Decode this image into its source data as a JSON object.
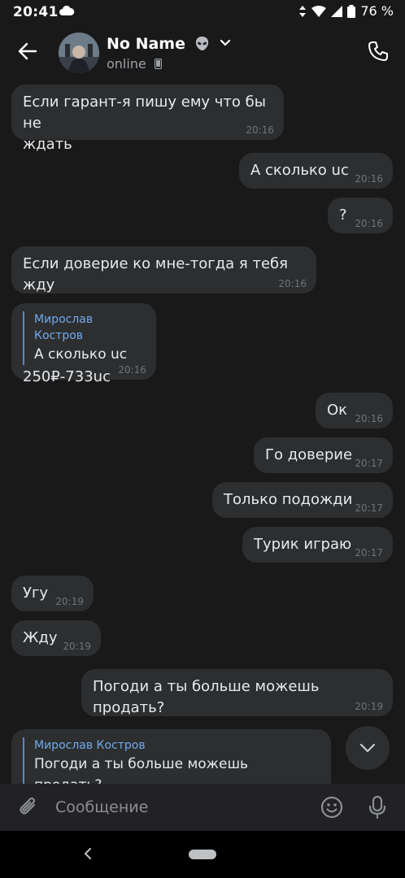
{
  "status_bar": {
    "time": "20:41",
    "battery": "76 %"
  },
  "header": {
    "name": "No Name",
    "status": "online"
  },
  "messages": [
    {
      "side": "in",
      "lines": [
        "Если гарант-я пишу ему что бы не",
        "ждать"
      ],
      "time": "20:16"
    },
    {
      "side": "out",
      "lines": [
        "А сколько uc"
      ],
      "time": "20:16"
    },
    {
      "side": "out",
      "lines": [
        "?"
      ],
      "time": "20:16"
    },
    {
      "side": "in",
      "lines": [
        "Если доверие ко мне-тогда я тебя жду"
      ],
      "time": "20:16"
    },
    {
      "side": "in",
      "quote_author": "Мирослав Костров",
      "quote_text": "А сколько uc",
      "lines": [
        "250₽-733uc"
      ],
      "time": "20:16"
    },
    {
      "side": "out",
      "lines": [
        "Ок"
      ],
      "time": "20:16"
    },
    {
      "side": "out",
      "lines": [
        "Го доверие"
      ],
      "time": "20:17"
    },
    {
      "side": "out",
      "lines": [
        "Только подожди"
      ],
      "time": "20:17"
    },
    {
      "side": "out",
      "lines": [
        "Турик играю"
      ],
      "time": "20:17"
    },
    {
      "side": "in",
      "lines": [
        "Угу"
      ],
      "time": "20:19"
    },
    {
      "side": "in",
      "lines": [
        "Жду"
      ],
      "time": "20:19"
    },
    {
      "side": "out",
      "lines": [
        "Погоди а ты больше можешь продать?"
      ],
      "time": "20:19"
    },
    {
      "side": "in",
      "quote_author": "Мирослав Костров",
      "quote_text": "Погоди а ты больше можешь продать?",
      "lines": [],
      "time": ""
    }
  ],
  "input": {
    "placeholder": "Сообщение"
  },
  "icons": {
    "back": "arrow-left-icon",
    "call": "phone-icon",
    "attach": "paperclip-icon",
    "emoji": "smile-icon",
    "mic": "microphone-icon",
    "scroll": "chevron-down-icon"
  },
  "colors": {
    "background": "#19191a",
    "bubble": "#2d2e30",
    "accent": "#71aaeb"
  }
}
